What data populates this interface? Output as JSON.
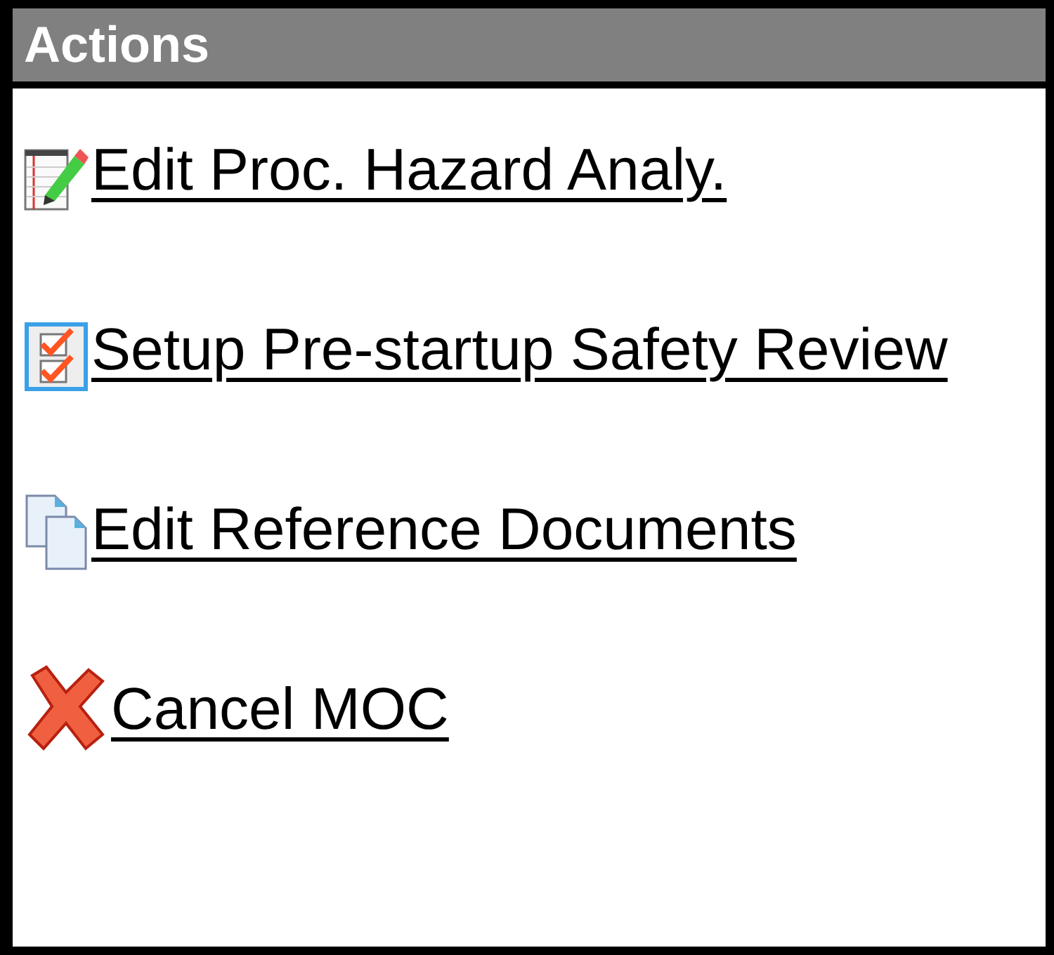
{
  "panel": {
    "title": "Actions"
  },
  "actions": [
    {
      "kind": "edit",
      "label": "Edit Proc. Hazard Analy."
    },
    {
      "kind": "checklist",
      "label": "Setup Pre-startup Safety Review"
    },
    {
      "kind": "documents",
      "label": "Edit Reference Documents"
    },
    {
      "kind": "cancel",
      "label": "Cancel MOC"
    }
  ]
}
